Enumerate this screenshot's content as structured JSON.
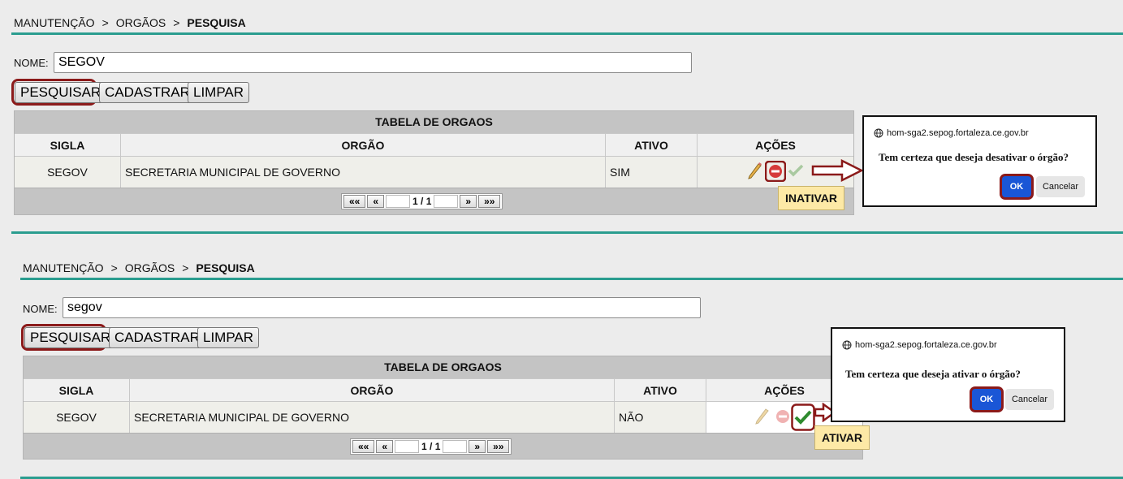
{
  "screens": [
    {
      "breadcrumb": {
        "item1": "MANUTENÇÃO",
        "item2": "ORGÃOS",
        "current": "PESQUISA",
        "separator": ">"
      },
      "search": {
        "label": "NOME:",
        "value": "SEGOV"
      },
      "buttons": {
        "search": "PESQUISAR",
        "register": "CADASTRAR",
        "clear": "LIMPAR"
      },
      "table": {
        "title": "TABELA DE ORGAOS",
        "headers": [
          "SIGLA",
          "ORGÃO",
          "ATIVO",
          "AÇÕES"
        ],
        "rows": [
          {
            "sigla": "SEGOV",
            "orgao": "SECRETARIA MUNICIPAL DE GOVERNO",
            "ativo": "SIM"
          }
        ],
        "pager": {
          "first": "««",
          "prev": "«",
          "info": "1 / 1",
          "next": "»",
          "last": "»»"
        }
      },
      "tooltip": "INATIVAR",
      "dialog": {
        "host": "hom-sga2.sepog.fortaleza.ce.gov.br",
        "message": "Tem certeza que deseja desativar o órgão?",
        "ok": "OK",
        "cancel": "Cancelar"
      }
    },
    {
      "breadcrumb": {
        "item1": "MANUTENÇÃO",
        "item2": "ORGÃOS",
        "current": "PESQUISA",
        "separator": ">"
      },
      "search": {
        "label": "NOME:",
        "value": "segov"
      },
      "buttons": {
        "search": "PESQUISAR",
        "register": "CADASTRAR",
        "clear": "LIMPAR"
      },
      "table": {
        "title": "TABELA DE ORGAOS",
        "headers": [
          "SIGLA",
          "ORGÃO",
          "ATIVO",
          "AÇÕES"
        ],
        "rows": [
          {
            "sigla": "SEGOV",
            "orgao": "SECRETARIA MUNICIPAL DE GOVERNO",
            "ativo": "NÃO"
          }
        ],
        "pager": {
          "first": "««",
          "prev": "«",
          "info": "1 / 1",
          "next": "»",
          "last": "»»"
        }
      },
      "tooltip": "ATIVAR",
      "dialog": {
        "host": "hom-sga2.sepog.fortaleza.ce.gov.br",
        "message": "Tem certeza que deseja ativar o órgão?",
        "ok": "OK",
        "cancel": "Cancelar"
      }
    }
  ],
  "colors": {
    "teal_divider": "#2a9d8f",
    "highlight": "#8b1a1a",
    "ok_button": "#1a56d6",
    "tooltip": "#fde9a6"
  },
  "icons": [
    "pencil-icon",
    "remove-circle-icon",
    "check-icon",
    "globe-icon",
    "right-arrow-icon"
  ]
}
